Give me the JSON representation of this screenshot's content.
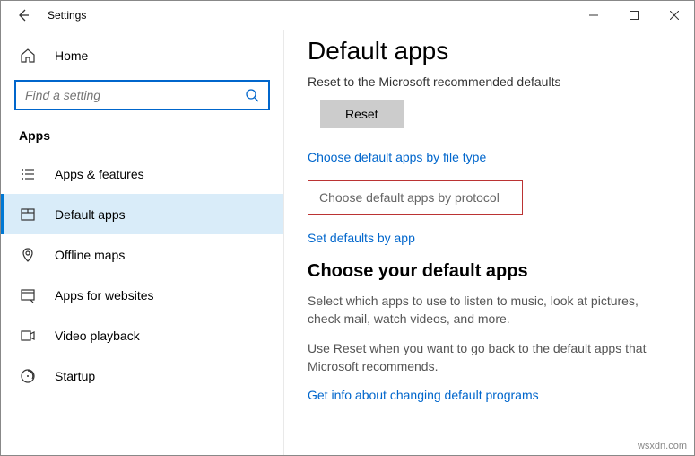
{
  "window": {
    "title": "Settings"
  },
  "sidebar": {
    "home": "Home",
    "search_placeholder": "Find a setting",
    "category": "Apps",
    "items": [
      {
        "label": "Apps & features"
      },
      {
        "label": "Default apps"
      },
      {
        "label": "Offline maps"
      },
      {
        "label": "Apps for websites"
      },
      {
        "label": "Video playback"
      },
      {
        "label": "Startup"
      }
    ]
  },
  "main": {
    "heading": "Default apps",
    "reset_text": "Reset to the Microsoft recommended defaults",
    "reset_button": "Reset",
    "link_file_type": "Choose default apps by file type",
    "link_protocol": "Choose default apps by protocol",
    "link_by_app": "Set defaults by app",
    "subheading": "Choose your default apps",
    "desc1": "Select which apps to use to listen to music, look at pictures, check mail, watch videos, and more.",
    "desc2": "Use Reset when you want to go back to the default apps that Microsoft recommends.",
    "link_info": "Get info about changing default programs"
  },
  "watermark": "wsxdn.com"
}
